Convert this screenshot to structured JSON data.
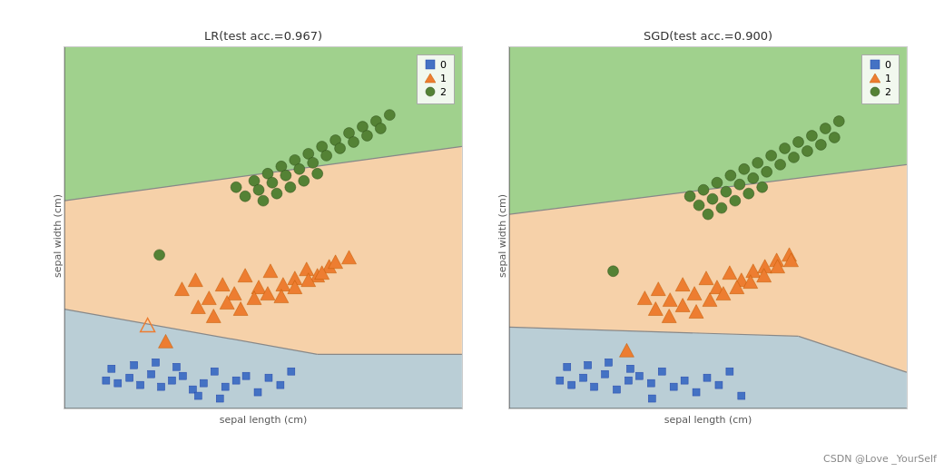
{
  "charts": [
    {
      "title": "LR(test acc.=0.967)",
      "x_label": "sepal length (cm)",
      "y_label": "sepal width (cm)",
      "legend": [
        {
          "label": "0",
          "shape": "square",
          "color": "#4472C4"
        },
        {
          "label": "1",
          "shape": "triangle",
          "color": "#ED7D31"
        },
        {
          "label": "2",
          "shape": "circle",
          "color": "#548235"
        }
      ]
    },
    {
      "title": "SGD(test acc.=0.900)",
      "x_label": "sepal length (cm)",
      "y_label": "sepal width (cm)",
      "legend": [
        {
          "label": "0",
          "shape": "square",
          "color": "#4472C4"
        },
        {
          "label": "1",
          "shape": "triangle",
          "color": "#ED7D31"
        },
        {
          "label": "2",
          "shape": "circle",
          "color": "#548235"
        }
      ]
    }
  ],
  "watermark": "CSDN @Love _YourSelf"
}
